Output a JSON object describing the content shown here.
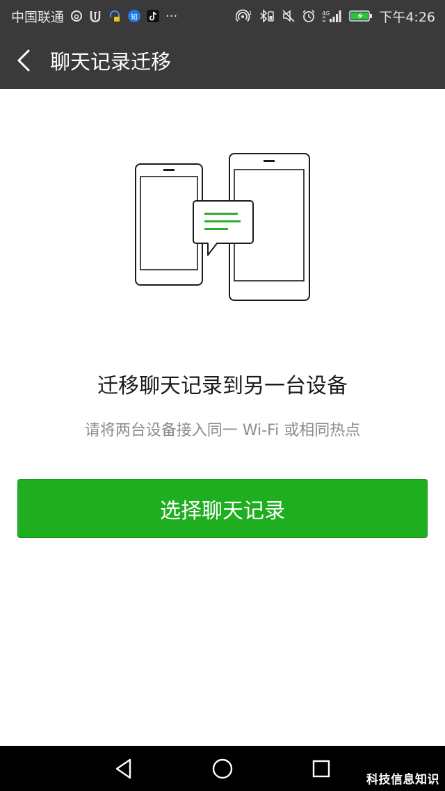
{
  "status_bar": {
    "carrier": "中国联通",
    "time": "下午4:26",
    "notification_icons": [
      "netease-music-icon",
      "ut-icon",
      "headset-app-icon",
      "zhihu-icon",
      "tiktok-icon",
      "more-dots-icon"
    ],
    "zhihu_badge": "知",
    "more": "···",
    "signal_label": "4G"
  },
  "nav": {
    "title": "聊天记录迁移"
  },
  "main": {
    "headline": "迁移聊天记录到另一台设备",
    "subtext": "请将两台设备接入同一 Wi-Fi 或相同热点",
    "primary_button": "选择聊天记录"
  },
  "watermark": "科技信息知识",
  "colors": {
    "bar_background": "#3a3a3a",
    "accent_green": "#1fae1f",
    "illustration_green": "#2aae2a"
  }
}
